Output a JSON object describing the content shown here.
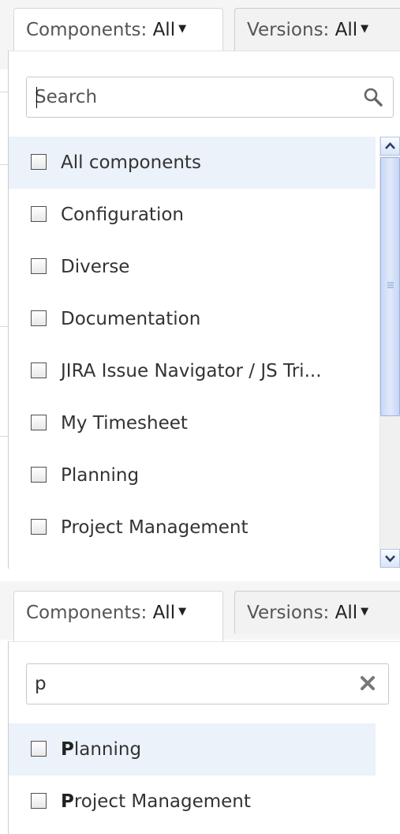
{
  "toolbar": {
    "components_label": "Components:",
    "components_value": "All",
    "versions_label": "Versions:",
    "versions_value": "All"
  },
  "dropdown_full": {
    "search_placeholder": "Search",
    "search_value": "",
    "items": [
      {
        "label": "All components"
      },
      {
        "label": "Configuration"
      },
      {
        "label": "Diverse"
      },
      {
        "label": "Documentation"
      },
      {
        "label": "JIRA Issue Navigator / JS Tri..."
      },
      {
        "label": "My Timesheet"
      },
      {
        "label": "Planning"
      },
      {
        "label": "Project Management"
      }
    ]
  },
  "dropdown_filtered": {
    "search_value": "p",
    "items": [
      {
        "match": "P",
        "rest": "lanning"
      },
      {
        "match": "P",
        "rest": "roject Management"
      }
    ]
  },
  "icons": {
    "search": "magnifier-icon",
    "clear": "x-icon",
    "caret": "▼"
  },
  "colors": {
    "active_row": "#ebf2f9",
    "scroll_thumb": "#c9d8f5"
  }
}
